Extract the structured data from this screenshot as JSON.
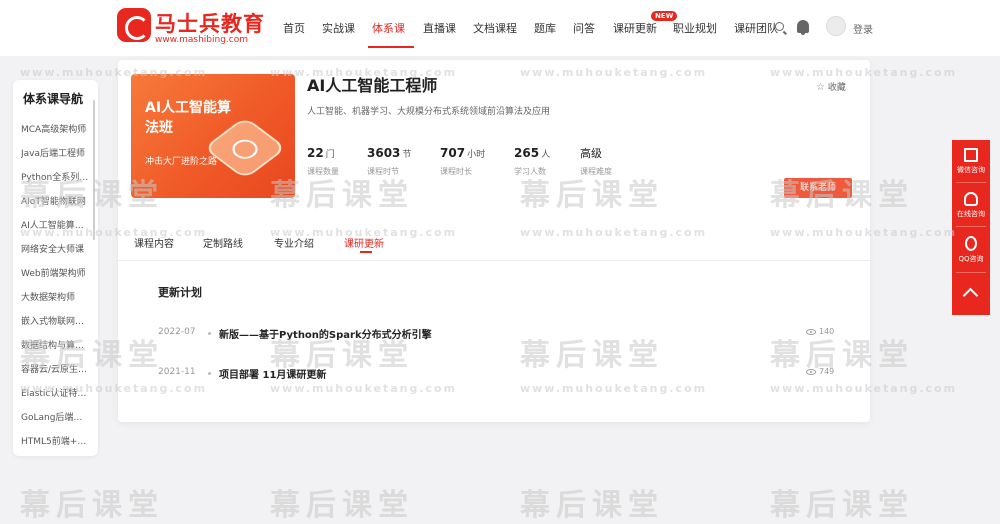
{
  "header": {
    "logo_text": "马士兵教育",
    "logo_url": "www.mashibing.com",
    "nav": [
      "首页",
      "实战课",
      "体系课",
      "直播课",
      "文档课程",
      "题库",
      "问答",
      "课研更新",
      "职业规划",
      "课研团队"
    ],
    "new_badge": "NEW",
    "login": "登录"
  },
  "sidebar": {
    "title": "体系课导航",
    "items": [
      "MCA高级架构师",
      "Java后端工程师",
      "Python全系列…",
      "AIoT智能物联网",
      "AI人工智能算…",
      "网络安全大师课",
      "Web前端架构师",
      "大数据架构师",
      "嵌入式物联网…",
      "数据结构与算…",
      "容器云/云原生…",
      "Elastic认证特…",
      "GoLang后端…",
      "HTML5前端+…"
    ]
  },
  "course": {
    "cover_title": "AI人工智能算法班",
    "cover_sub": "冲击大厂进阶之路",
    "title": "AI人工智能工程师",
    "desc": "人工智能、机器学习、大规模分布式系统领域前沿算法及应用",
    "fav": "收藏",
    "stats": [
      {
        "value": "22",
        "unit": "门",
        "label": "课程数量"
      },
      {
        "value": "3603",
        "unit": "节",
        "label": "课程时节"
      },
      {
        "value": "707",
        "unit": "小时",
        "label": "课程时长"
      },
      {
        "value": "265",
        "unit": "人",
        "label": "学习人数"
      },
      {
        "value": "高级",
        "unit": "",
        "label": "课程难度"
      }
    ],
    "contact": "联系老师"
  },
  "tabs": [
    "课程内容",
    "定制路线",
    "专业介绍",
    "课研更新"
  ],
  "updates": {
    "title": "更新计划",
    "items": [
      {
        "date": "2022-07",
        "text": "新版——基于Python的Spark分布式分析引擎",
        "views": "140"
      },
      {
        "date": "2021-11",
        "text": "项目部署 11月课研更新",
        "views": "749"
      }
    ]
  },
  "float": {
    "wechat": "微信咨询",
    "online": "在线咨询",
    "qq": "QQ咨询"
  },
  "watermark": {
    "big": "幕后课堂",
    "small": "www.muhouketang.com"
  },
  "colors": {
    "accent": "#e8271f",
    "cover": "#f05a28"
  }
}
